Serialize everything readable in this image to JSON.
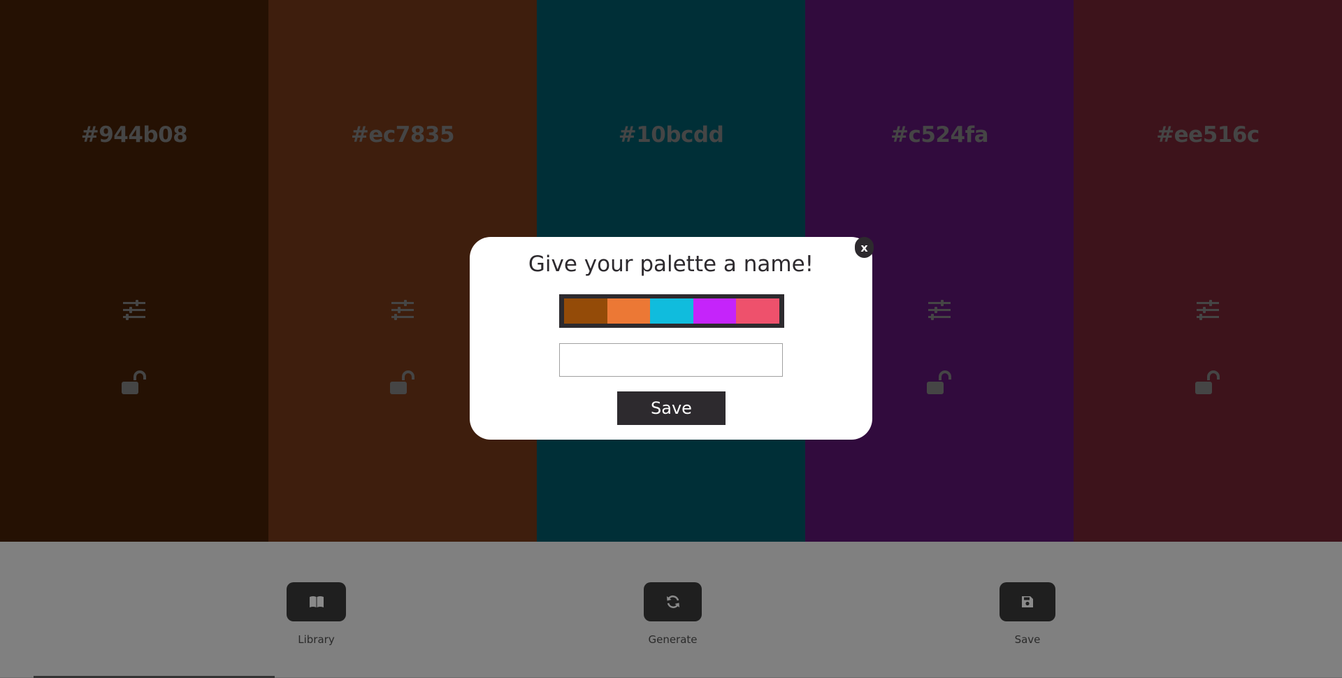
{
  "palette": {
    "columns": [
      {
        "hex": "#944b08",
        "display_color": "#4a2306"
      },
      {
        "hex": "#ec7835",
        "display_color": "#7c3c1b"
      },
      {
        "hex": "#10bcdd",
        "display_color": "#015e6f"
      },
      {
        "hex": "#c524fa",
        "display_color": "#63177b"
      },
      {
        "hex": "#ee516c",
        "display_color": "#7b2736"
      }
    ],
    "adjust_icon": "sliders-icon",
    "lock_icon": "unlock-icon",
    "icon_color": "#8a8a8a"
  },
  "panel": {
    "buttons": [
      {
        "label": "Library",
        "icon": "book-icon"
      },
      {
        "label": "Generate",
        "icon": "refresh-icon"
      },
      {
        "label": "Save",
        "icon": "floppy-disk-icon"
      }
    ]
  },
  "modal": {
    "title": "Give your palette a name!",
    "close_label": "x",
    "input_value": "",
    "input_placeholder": "",
    "save_label": "Save",
    "preview_colors": [
      "#944b08",
      "#ec7835",
      "#10bcdd",
      "#c524fa",
      "#ee516c"
    ]
  }
}
